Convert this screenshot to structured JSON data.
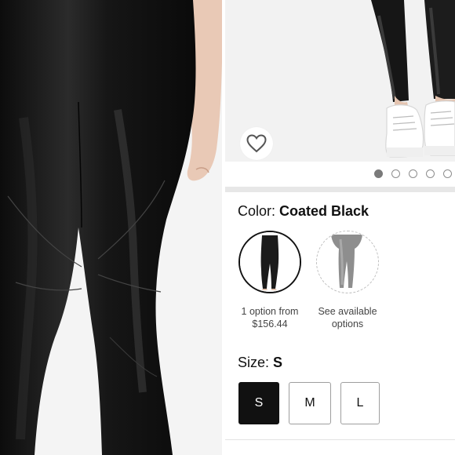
{
  "product_image": {
    "favorite_icon": "heart-outline-icon"
  },
  "carousel": {
    "dot_count": 5,
    "active_index": 0
  },
  "color": {
    "label": "Color:",
    "selected_value": "Coated Black",
    "swatches": [
      {
        "caption_line1": "1 option from",
        "caption_line2": "$156.44",
        "selected": true,
        "tone": "#1b1b1b"
      },
      {
        "caption_line1": "See available",
        "caption_line2": "options",
        "selected": false,
        "tone": "#8e8e8e"
      }
    ]
  },
  "size": {
    "label": "Size:",
    "selected_value": "S",
    "options": [
      "S",
      "M",
      "L"
    ]
  },
  "colors": {
    "selected_fill": "#111111",
    "border": "#9e9e9e",
    "divider": "#e7e7e7"
  }
}
